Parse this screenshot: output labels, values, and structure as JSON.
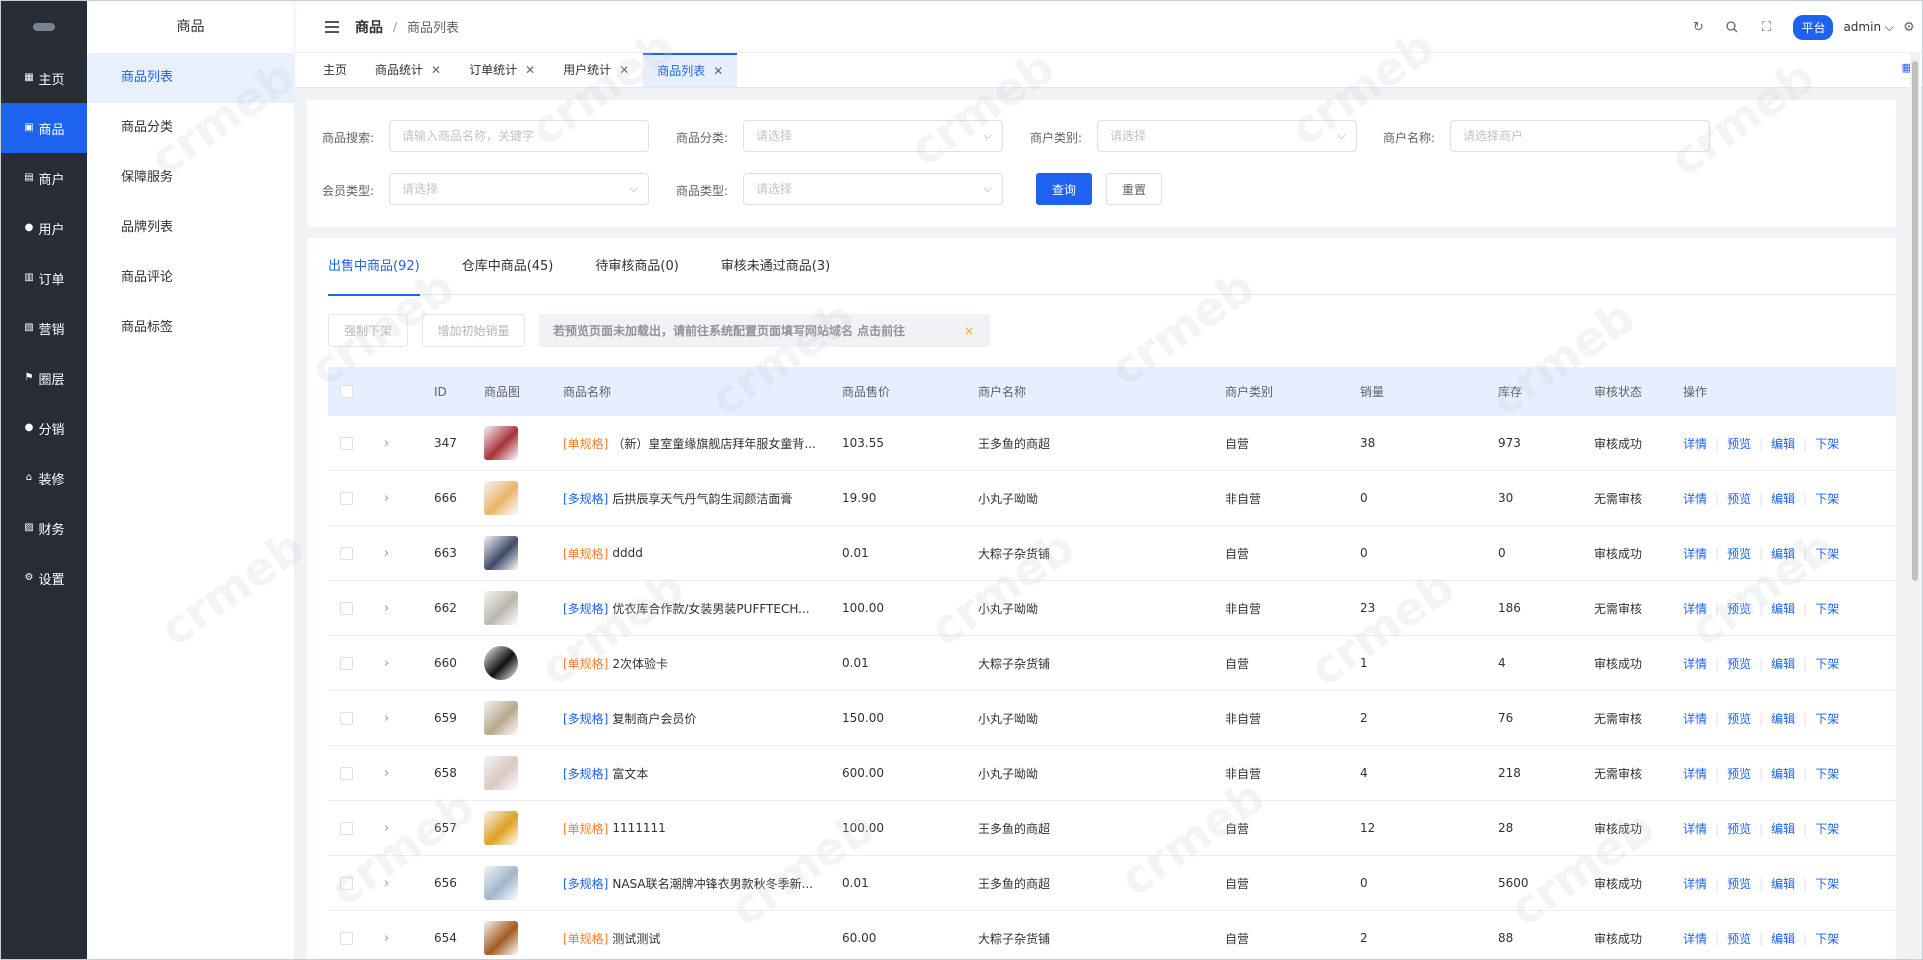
{
  "sidebar": {
    "items": [
      {
        "label": "主页",
        "icon": "grid-icon"
      },
      {
        "label": "商品",
        "icon": "bag-icon"
      },
      {
        "label": "商户",
        "icon": "shop-icon"
      },
      {
        "label": "用户",
        "icon": "user-icon"
      },
      {
        "label": "订单",
        "icon": "order-icon"
      },
      {
        "label": "营销",
        "icon": "marketing-icon"
      },
      {
        "label": "圈层",
        "icon": "flag-icon"
      },
      {
        "label": "分销",
        "icon": "distribution-icon"
      },
      {
        "label": "装修",
        "icon": "home-icon"
      },
      {
        "label": "财务",
        "icon": "finance-icon"
      },
      {
        "label": "设置",
        "icon": "gear-icon"
      }
    ]
  },
  "submenu": {
    "title": "商品",
    "items": [
      "商品列表",
      "商品分类",
      "保障服务",
      "品牌列表",
      "商品评论",
      "商品标签"
    ]
  },
  "header": {
    "breadcrumb_root": "商品",
    "breadcrumb_sep": "/",
    "breadcrumb_current": "商品列表",
    "badge": "平台",
    "user": "admin"
  },
  "tabs": [
    {
      "label": "主页"
    },
    {
      "label": "商品统计"
    },
    {
      "label": "订单统计"
    },
    {
      "label": "用户统计"
    },
    {
      "label": "商品列表"
    }
  ],
  "filters": {
    "search_label": "商品搜索:",
    "search_placeholder": "请输入商品名称，关键字",
    "category_label": "商品分类:",
    "category_placeholder": "请选择",
    "merchant_type_label": "商户类别:",
    "merchant_type_placeholder": "请选择",
    "merchant_name_label": "商户名称:",
    "merchant_name_placeholder": "请选择商户",
    "member_label": "会员类型:",
    "member_placeholder": "请选择",
    "product_type_label": "商品类型:",
    "product_type_placeholder": "请选择",
    "query_btn": "查询",
    "reset_btn": "重置"
  },
  "product_tabs": [
    "出售中商品(92)",
    "仓库中商品(45)",
    "待审核商品(0)",
    "审核未通过商品(3)"
  ],
  "actions": {
    "force_off": "强制下架",
    "add_sales": "增加初始销量",
    "notice": "若预览页面未加载出，请前往系统配置页面填写网站域名  点击前往",
    "notice_close": "×"
  },
  "table": {
    "headers": [
      "ID",
      "商品图",
      "商品名称",
      "商品售价",
      "商户名称",
      "商户类别",
      "销量",
      "库存",
      "审核状态",
      "操作"
    ],
    "ops": [
      "详情",
      "预览",
      "编辑",
      "下架"
    ],
    "rows": [
      {
        "id": "347",
        "tag": "[单规格]",
        "tagtype": "s",
        "name": "（新）皇室童缘旗舰店拜年服女童背...",
        "price": "103.55",
        "merchant": "王多鱼的商超",
        "mtype": "自营",
        "sales": "38",
        "stock": "973",
        "status": "审核成功",
        "img": "#a8323a"
      },
      {
        "id": "666",
        "tag": "[多规格]",
        "tagtype": "m",
        "name": "后拱辰享天气丹气韵生润颜洁面膏",
        "price": "19.90",
        "merchant": "小丸子呦呦",
        "mtype": "非自营",
        "sales": "0",
        "stock": "30",
        "status": "无需审核",
        "img": "#e8b56a"
      },
      {
        "id": "663",
        "tag": "[单规格]",
        "tagtype": "s",
        "name": "dddd",
        "price": "0.01",
        "merchant": "大粽子杂货铺",
        "mtype": "自营",
        "sales": "0",
        "stock": "0",
        "status": "审核成功",
        "img": "#3e4a66"
      },
      {
        "id": "662",
        "tag": "[多规格]",
        "tagtype": "m",
        "name": "优衣库合作款/女装男装PUFFTECH...",
        "price": "100.00",
        "merchant": "小丸子呦呦",
        "mtype": "非自营",
        "sales": "23",
        "stock": "186",
        "status": "无需审核",
        "img": "#b9b7ad"
      },
      {
        "id": "660",
        "tag": "[单规格]",
        "tagtype": "s",
        "name": "2次体验卡",
        "price": "0.01",
        "merchant": "大粽子杂货铺",
        "mtype": "自营",
        "sales": "1",
        "stock": "4",
        "status": "审核成功",
        "img": "#111111"
      },
      {
        "id": "659",
        "tag": "[多规格]",
        "tagtype": "m",
        "name": "复制商户会员价",
        "price": "150.00",
        "merchant": "小丸子呦呦",
        "mtype": "非自营",
        "sales": "2",
        "stock": "76",
        "status": "无需审核",
        "img": "#b8a88a"
      },
      {
        "id": "658",
        "tag": "[多规格]",
        "tagtype": "m",
        "name": "富文本",
        "price": "600.00",
        "merchant": "小丸子呦呦",
        "mtype": "非自营",
        "sales": "4",
        "stock": "218",
        "status": "无需审核",
        "img": "#d8c8c0"
      },
      {
        "id": "657",
        "tag": "[单规格]",
        "tagtype": "s",
        "name": "1111111",
        "price": "100.00",
        "merchant": "王多鱼的商超",
        "mtype": "自营",
        "sales": "12",
        "stock": "28",
        "status": "审核成功",
        "img": "#e0a020"
      },
      {
        "id": "656",
        "tag": "[多规格]",
        "tagtype": "m",
        "name": "NASA联名潮牌冲锋衣男款秋冬季新...",
        "price": "0.01",
        "merchant": "王多鱼的商超",
        "mtype": "自营",
        "sales": "0",
        "stock": "5600",
        "status": "审核成功",
        "img": "#9fb6cc"
      },
      {
        "id": "654",
        "tag": "[单规格]",
        "tagtype": "s",
        "name": "测试测试",
        "price": "60.00",
        "merchant": "大粽子杂货铺",
        "mtype": "自营",
        "sales": "2",
        "stock": "88",
        "status": "审核成功",
        "img": "#a25a20"
      }
    ]
  },
  "colors": {
    "primary": "#1d63f0",
    "sidebar": "#282c34",
    "single_tag": "#ff7d2b",
    "multi_tag": "#1d63f0"
  }
}
